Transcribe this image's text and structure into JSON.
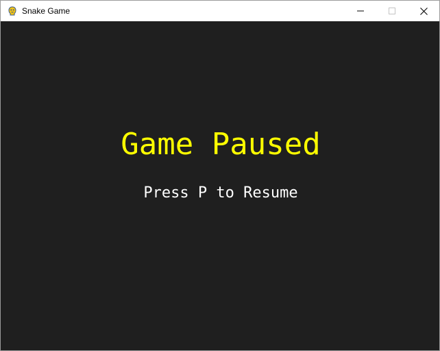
{
  "window": {
    "title": "Snake Game",
    "app_icon": "pygame-snake-icon",
    "controls": {
      "minimize_icon": "minimize-icon",
      "maximize_icon": "maximize-icon",
      "close_icon": "close-icon"
    }
  },
  "game": {
    "state_title": "Game Paused",
    "resume_hint": "Press P to Resume"
  },
  "colors": {
    "background": "#1f1f1f",
    "title_text": "#ffff00",
    "hint_text": "#ffffff",
    "titlebar": "#ffffff"
  }
}
